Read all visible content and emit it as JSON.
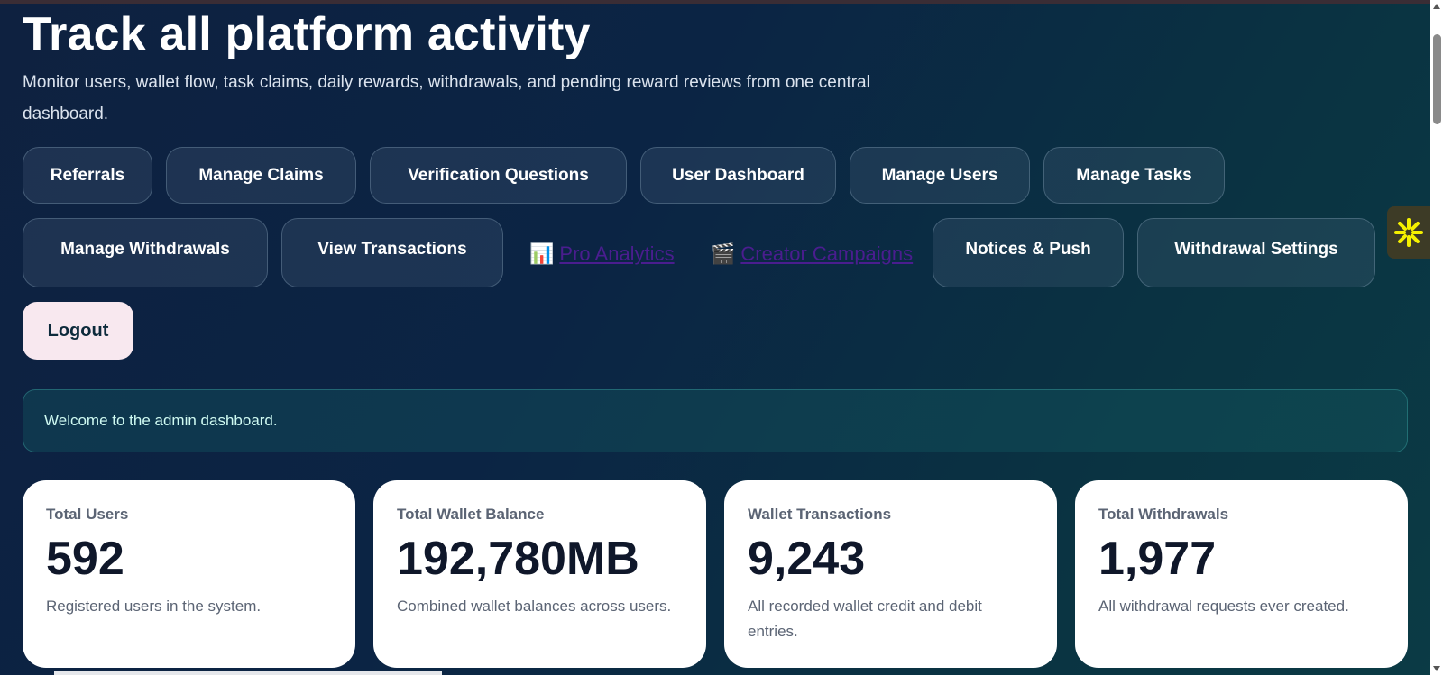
{
  "header": {
    "title": "Track all platform activity",
    "subtitle": "Monitor users, wallet flow, task claims, daily rewards, withdrawals, and pending reward reviews from one central dashboard."
  },
  "nav": {
    "referrals": "Referrals",
    "manage_claims": "Manage Claims",
    "verification_questions": "Verification Questions",
    "user_dashboard": "User Dashboard",
    "manage_users": "Manage Users",
    "manage_tasks": "Manage Tasks",
    "manage_withdrawals": "Manage Withdrawals",
    "view_transactions": "View Transactions",
    "pro_analytics": "Pro Analytics",
    "pro_analytics_emoji": "📊",
    "creator_campaigns": "Creator Campaigns",
    "creator_campaigns_emoji": "🎬",
    "notices_push": "Notices & Push",
    "withdrawal_settings": "Withdrawal Settings",
    "logout": "Logout"
  },
  "alert": {
    "message": "Welcome to the admin dashboard."
  },
  "stats": [
    {
      "label": "Total Users",
      "value": "592",
      "desc": "Registered users in the system."
    },
    {
      "label": "Total Wallet Balance",
      "value": "192,780MB",
      "desc": "Combined wallet balances across users."
    },
    {
      "label": "Wallet Transactions",
      "value": "9,243",
      "desc": "All recorded wallet credit and debit entries."
    },
    {
      "label": "Total Withdrawals",
      "value": "1,977",
      "desc": "All withdrawal requests ever created."
    }
  ],
  "colors": {
    "link": "#4a1d8f",
    "logout_bg": "#f8e8ef",
    "alert_text": "#cffaf2",
    "widget_icon": "#f4f000"
  },
  "icons": {
    "widget": "asterisk-burst-icon"
  }
}
